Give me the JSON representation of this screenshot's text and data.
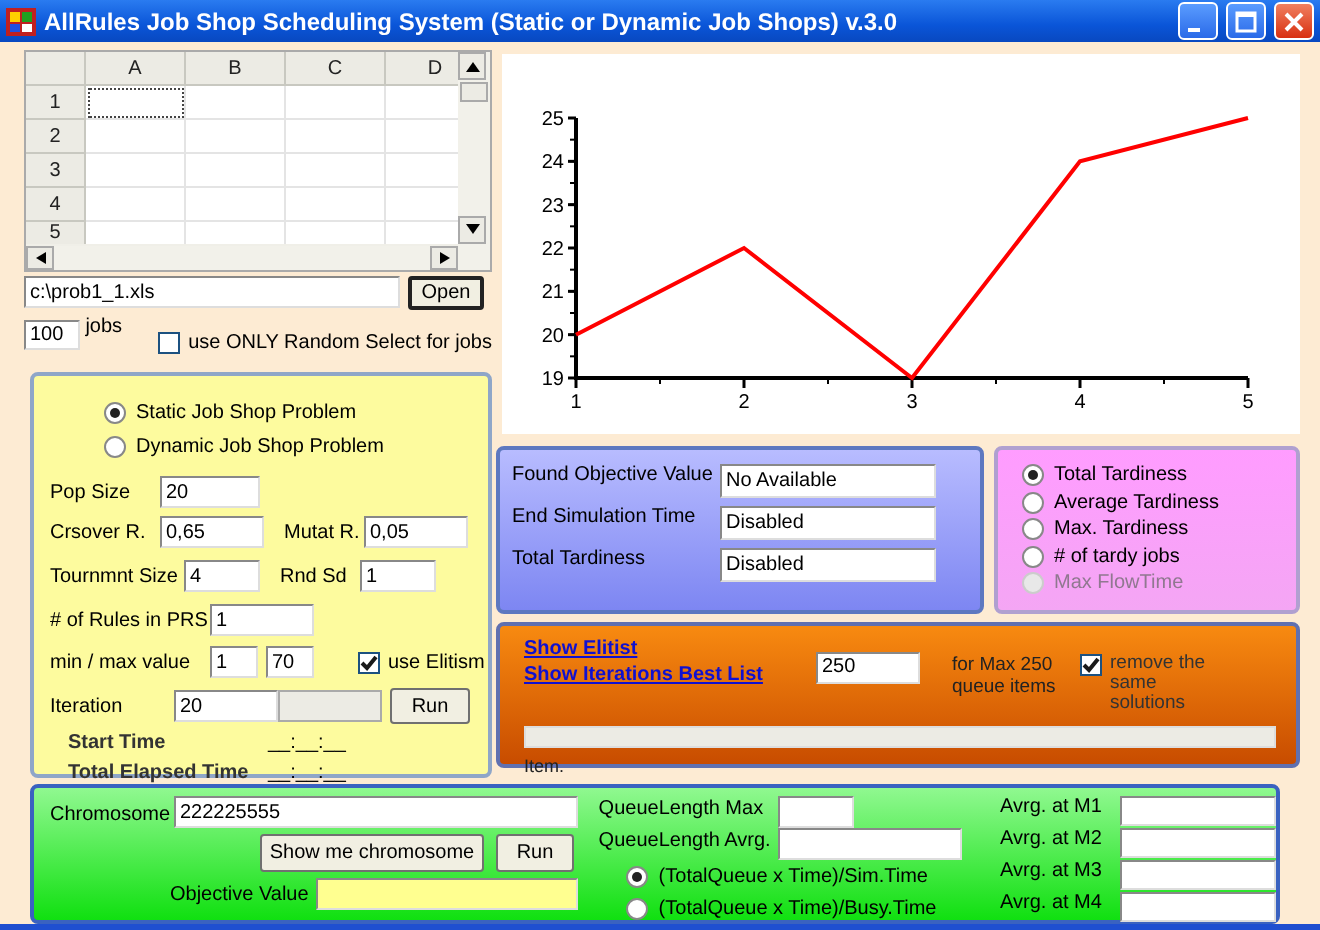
{
  "window": {
    "title": "AllRules Job Shop Scheduling System (Static or Dynamic Job Shops) v.3.0"
  },
  "spreadsheet": {
    "columns": [
      "A",
      "B",
      "C",
      "D"
    ],
    "rows": [
      "1",
      "2",
      "3",
      "4",
      "5"
    ]
  },
  "file": {
    "path": "c:\\prob1_1.xls",
    "button": "Open"
  },
  "jobs": {
    "value": "100",
    "label": "jobs"
  },
  "random_select": {
    "label": "use ONLY Random Select for jobs",
    "checked": false
  },
  "problem_types": [
    {
      "label": "Static Job Shop Problem",
      "selected": true
    },
    {
      "label": "Dynamic Job Shop Problem",
      "selected": false
    }
  ],
  "parameters": {
    "pop_size": {
      "label": "Pop Size",
      "value": "20"
    },
    "crossover": {
      "label": "Crsover R.",
      "value": "0,65"
    },
    "mutation": {
      "label": "Mutat R.",
      "value": "0,05"
    },
    "tournament": {
      "label": "Tournmnt Size",
      "value": "4"
    },
    "seed": {
      "label": "Rnd Sd",
      "value": "1"
    },
    "rules": {
      "label": "# of Rules in PRS",
      "value": "1"
    },
    "range": {
      "label": "min / max value",
      "min": "1",
      "max": "70"
    },
    "elitism": {
      "label": "use Elitism",
      "checked": true
    },
    "iteration": {
      "label": "Iteration",
      "value": "20",
      "level": 0
    },
    "run_button": "Run",
    "start_time": {
      "label": "Start Time",
      "value": "__:__:__"
    },
    "elapsed_time": {
      "label": "Total Elapsed Time",
      "value": "__:__:__"
    }
  },
  "chart": {
    "chart_data": {
      "type": "line",
      "x": [
        1,
        2,
        3,
        4,
        5
      ],
      "xlim": [
        1,
        5
      ],
      "ylim": [
        19,
        25
      ],
      "xticks": [
        1,
        2,
        3,
        4,
        5
      ],
      "yticks": [
        19,
        20,
        21,
        22,
        23,
        24,
        25
      ],
      "series": [
        {
          "color": "#ff0000",
          "values": [
            20,
            22,
            19,
            24,
            25
          ]
        }
      ]
    }
  },
  "results": [
    {
      "label": "Found Objective Value",
      "value": "No Available"
    },
    {
      "label": "End Simulation Time",
      "value": "Disabled"
    },
    {
      "label": "Total Tardiness",
      "value": "Disabled"
    }
  ],
  "objectives": [
    {
      "label": "Total Tardiness",
      "selected": true,
      "disabled": false
    },
    {
      "label": "Average Tardiness",
      "selected": false,
      "disabled": false
    },
    {
      "label": "Max. Tardiness",
      "selected": false,
      "disabled": false
    },
    {
      "label": "# of tardy jobs",
      "selected": false,
      "disabled": false
    },
    {
      "label": "Max FlowTime",
      "selected": false,
      "disabled": true
    }
  ],
  "elitist": {
    "links": [
      "Show Elitist",
      "Show Iterations Best List"
    ],
    "queue_size": "250",
    "note": "for Max 250 queue items",
    "remove_duplicates": {
      "label": "remove the same solutions",
      "checked": true
    },
    "level": 0,
    "status": "Item."
  },
  "chromosome": {
    "label": "Chromosome",
    "value": "222225555",
    "show_button": "Show me chromosome",
    "run_button": "Run",
    "objective_label": "Objective Value"
  },
  "queue": {
    "max_label": "QueueLength  Max",
    "avg_label": "QueueLength  Avrg.",
    "modes": [
      {
        "label": "(TotalQueue x Time)/Sim.Time",
        "selected": true
      },
      {
        "label": "(TotalQueue x Time)/Busy.Time",
        "selected": false
      }
    ]
  },
  "machines": [
    "Avrg. at M1",
    "Avrg. at M2",
    "Avrg. at M3",
    "Avrg. at M4"
  ]
}
